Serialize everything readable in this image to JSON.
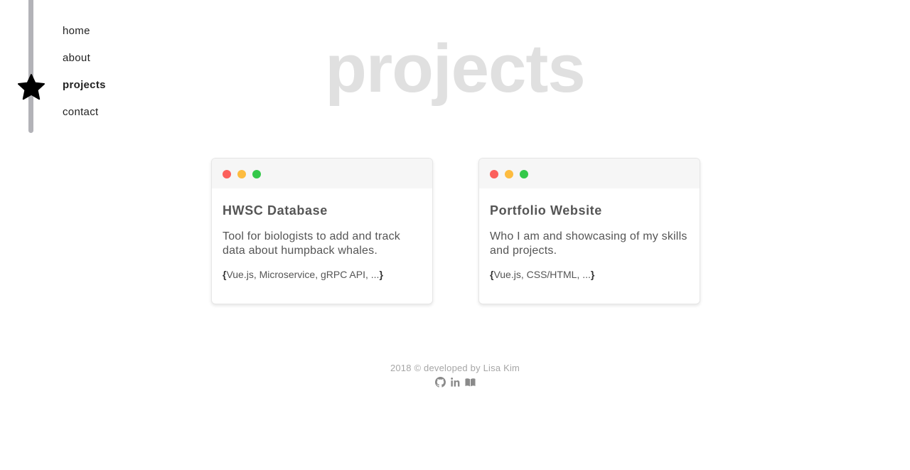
{
  "nav": {
    "items": [
      {
        "label": "home"
      },
      {
        "label": "about"
      },
      {
        "label": "projects",
        "active": true
      },
      {
        "label": "contact"
      }
    ],
    "active_marker_icon": "star-icon"
  },
  "page": {
    "heading": "projects"
  },
  "projects": [
    {
      "title": "HWSC Database",
      "description": "Tool for biologists to add and track data about humpback whales.",
      "tags": "Vue.js, Microservice, gRPC API, ...",
      "window_dots": [
        "#fc605c",
        "#fdbc40",
        "#34c84a"
      ]
    },
    {
      "title": "Portfolio Website",
      "description": "Who I am and showcasing of my skills and projects.",
      "tags": "Vue.js, CSS/HTML, ...",
      "window_dots": [
        "#fc605c",
        "#fdbc40",
        "#34c84a"
      ]
    }
  ],
  "footer": {
    "text": "2018 © developed by Lisa Kim",
    "icons": [
      "github-icon",
      "linkedin-icon",
      "book-icon"
    ]
  },
  "colors": {
    "heading": "#e0e0e0",
    "rail": "#b3b3b8",
    "footer_text": "#a6a6a6"
  }
}
